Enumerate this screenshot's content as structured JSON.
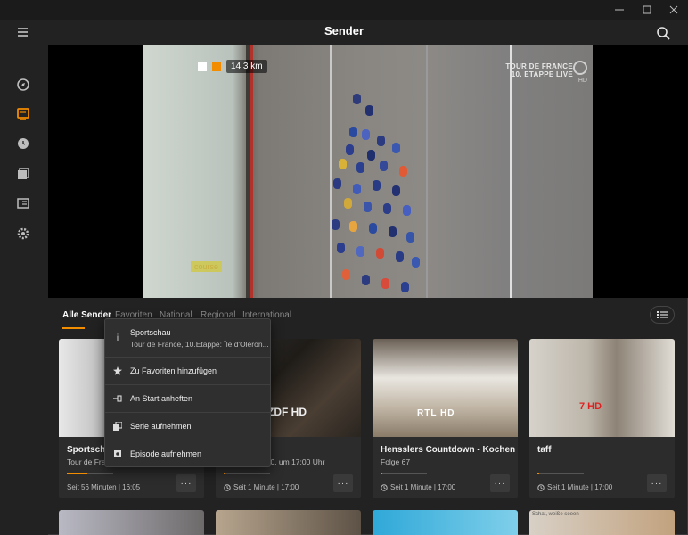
{
  "header": {
    "title": "Sender"
  },
  "sidebar": {
    "items": [
      {
        "name": "explore-icon"
      },
      {
        "name": "tv-channels-icon",
        "active": true
      },
      {
        "name": "clock-icon"
      },
      {
        "name": "library-icon"
      },
      {
        "name": "recordings-icon"
      },
      {
        "name": "settings-icon"
      }
    ],
    "accent_color": "#f28c00"
  },
  "player": {
    "km_readout": "14,3 km",
    "overlay_line1": "TOUR DE FRANCE",
    "overlay_line2": "10. ETAPPE LIVE",
    "overlay_hd": "HD",
    "course_label": "course"
  },
  "tabs": [
    {
      "label": "Alle Sender",
      "active": true
    },
    {
      "label": "Favoriten"
    },
    {
      "label": "National"
    },
    {
      "label": "Regional"
    },
    {
      "label": "International"
    }
  ],
  "cards": [
    {
      "title": "Sportschau",
      "subtitle": "Tour de France",
      "time": "Seit 56 Minuten | 16:05",
      "progress": 0.45
    },
    {
      "channel_logo": "ZDF HD",
      "title": "",
      "subtitle": "020, um 17:00 Uhr",
      "time": "Seit 1 Minute | 17:00",
      "progress": 0.03
    },
    {
      "channel_logo": "RTL HD",
      "title": "Hensslers Countdown - Kochen",
      "subtitle": "Folge 67",
      "time": "Seit 1 Minute | 17:00",
      "progress": 0.03
    },
    {
      "channel_logo": "7 HD",
      "title": "taff",
      "subtitle": "",
      "time": "Seit 1 Minute | 17:00",
      "progress": 0.03
    }
  ],
  "peek_card_text": "Schat, weiße seeen",
  "context_menu": {
    "header_title": "Sportschau",
    "header_subtitle": "Tour de France, 10.Etappe: Île d'Oléron...",
    "items": [
      {
        "label": "Zu Favoriten hinzufügen",
        "icon": "star-icon"
      },
      {
        "label": "An Start anheften",
        "icon": "pin-icon"
      },
      {
        "label": "Serie aufnehmen",
        "icon": "series-record-icon"
      },
      {
        "label": "Episode aufnehmen",
        "icon": "episode-record-icon"
      }
    ]
  },
  "more_button_label": "···"
}
